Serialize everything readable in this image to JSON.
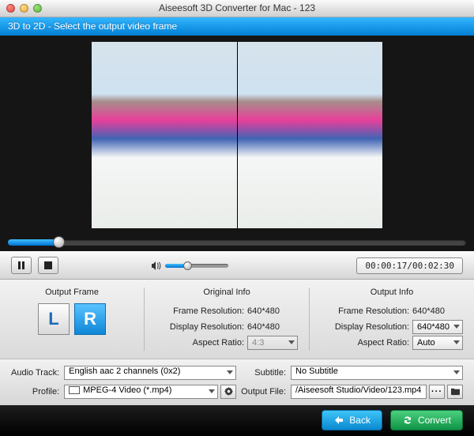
{
  "window": {
    "title": "Aiseesoft 3D Converter for Mac - 123"
  },
  "banner": "3D to 2D - Select the output video frame",
  "player": {
    "seek_percent": 11,
    "volume_percent": 35,
    "elapsed": "00:00:17",
    "total": "00:02:30"
  },
  "output_frame": {
    "heading": "Output Frame",
    "left_label": "L",
    "right_label": "R",
    "selected": "R"
  },
  "original_info": {
    "heading": "Original Info",
    "frame_resolution_label": "Frame Resolution:",
    "frame_resolution_value": "640*480",
    "display_resolution_label": "Display Resolution:",
    "display_resolution_value": "640*480",
    "aspect_ratio_label": "Aspect Ratio:",
    "aspect_ratio_value": "4:3"
  },
  "output_info": {
    "heading": "Output Info",
    "frame_resolution_label": "Frame Resolution:",
    "frame_resolution_value": "640*480",
    "display_resolution_label": "Display Resolution:",
    "display_resolution_value": "640*480",
    "aspect_ratio_label": "Aspect Ratio:",
    "aspect_ratio_value": "Auto"
  },
  "form": {
    "audio_track_label": "Audio Track:",
    "audio_track_value": "English aac 2 channels (0x2)",
    "subtitle_label": "Subtitle:",
    "subtitle_value": "No Subtitle",
    "profile_label": "Profile:",
    "profile_value": "MPEG-4 Video (*.mp4)",
    "output_file_label": "Output File:",
    "output_file_value": "/Aiseesoft Studio/Video/123.mp4"
  },
  "footer": {
    "back_label": "Back",
    "convert_label": "Convert"
  }
}
